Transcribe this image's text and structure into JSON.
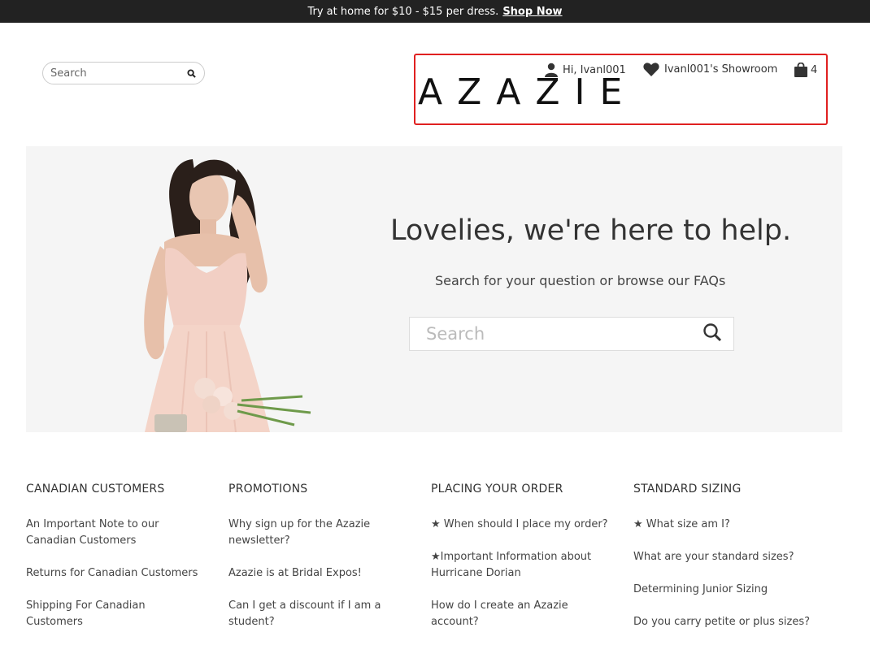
{
  "promo": {
    "text": "Try at home for $10 - $15 per dress.",
    "link": "Shop Now"
  },
  "top_search": {
    "placeholder": "Search"
  },
  "header": {
    "logo": "AZAZIE",
    "user": "Hi, Ivanl001",
    "showroom": "Ivanl001's Showroom",
    "cart_count": "4",
    "highlight_color": "#e02020"
  },
  "hero": {
    "title": "Lovelies, we're here to help.",
    "subtitle": "Search for your question or browse our FAQs",
    "search_placeholder": "Search"
  },
  "faq_columns": [
    {
      "heading": "CANADIAN CUSTOMERS",
      "items": [
        "An Important Note to our Canadian Customers",
        "Returns for Canadian Customers",
        "Shipping For Canadian Customers"
      ]
    },
    {
      "heading": "PROMOTIONS",
      "items": [
        "Why sign up for the Azazie newsletter?",
        "Azazie is at Bridal Expos!",
        "Can I get a discount if I am a student?"
      ]
    },
    {
      "heading": "PLACING YOUR ORDER",
      "items": [
        "★ When should I place my order?",
        "★Important Information about Hurricane Dorian",
        "How do I create an Azazie account?"
      ]
    },
    {
      "heading": "STANDARD SIZING",
      "items": [
        "★ What size am I?",
        "What are your standard sizes?",
        "Determining Junior Sizing",
        "Do you carry petite or plus sizes?"
      ]
    }
  ]
}
